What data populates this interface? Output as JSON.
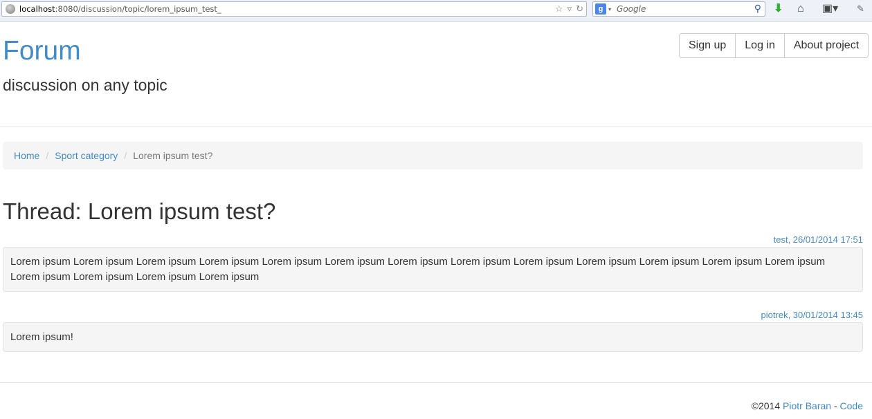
{
  "browser": {
    "url_host": "localhost",
    "url_rest": ":8080/discussion/topic/lorem_ipsum_test_",
    "search_placeholder": "Google",
    "search_engine_badge": "g",
    "icons": [
      "globe-icon",
      "star-icon",
      "dropdown-icon",
      "reload-icon",
      "search-icon",
      "download-icon",
      "home-icon",
      "bookmarks-icon",
      "extension-icon"
    ]
  },
  "header": {
    "brand": "Forum",
    "tagline": "discussion on any topic",
    "nav": [
      "Sign up",
      "Log in",
      "About project"
    ]
  },
  "breadcrumb": {
    "items": [
      "Home",
      "Sport category"
    ],
    "active": "Lorem ipsum test?",
    "separator": "/"
  },
  "thread": {
    "title": "Thread: Lorem ipsum test?",
    "posts": [
      {
        "meta": "test, 26/01/2014 17:51",
        "body": "Lorem ipsum Lorem ipsum Lorem ipsum Lorem ipsum Lorem ipsum Lorem ipsum Lorem ipsum Lorem ipsum Lorem ipsum Lorem ipsum Lorem ipsum Lorem ipsum Lorem ipsum Lorem ipsum Lorem ipsum Lorem ipsum Lorem ipsum"
      },
      {
        "meta": "piotrek, 30/01/2014 13:45",
        "body": "Lorem ipsum!"
      }
    ]
  },
  "footer": {
    "copyright": "©2014",
    "author": "Piotr Baran",
    "dash": "-",
    "code_link": "Code"
  },
  "colors": {
    "link": "#428bca",
    "text": "#333333",
    "well": "#f5f5f5"
  }
}
